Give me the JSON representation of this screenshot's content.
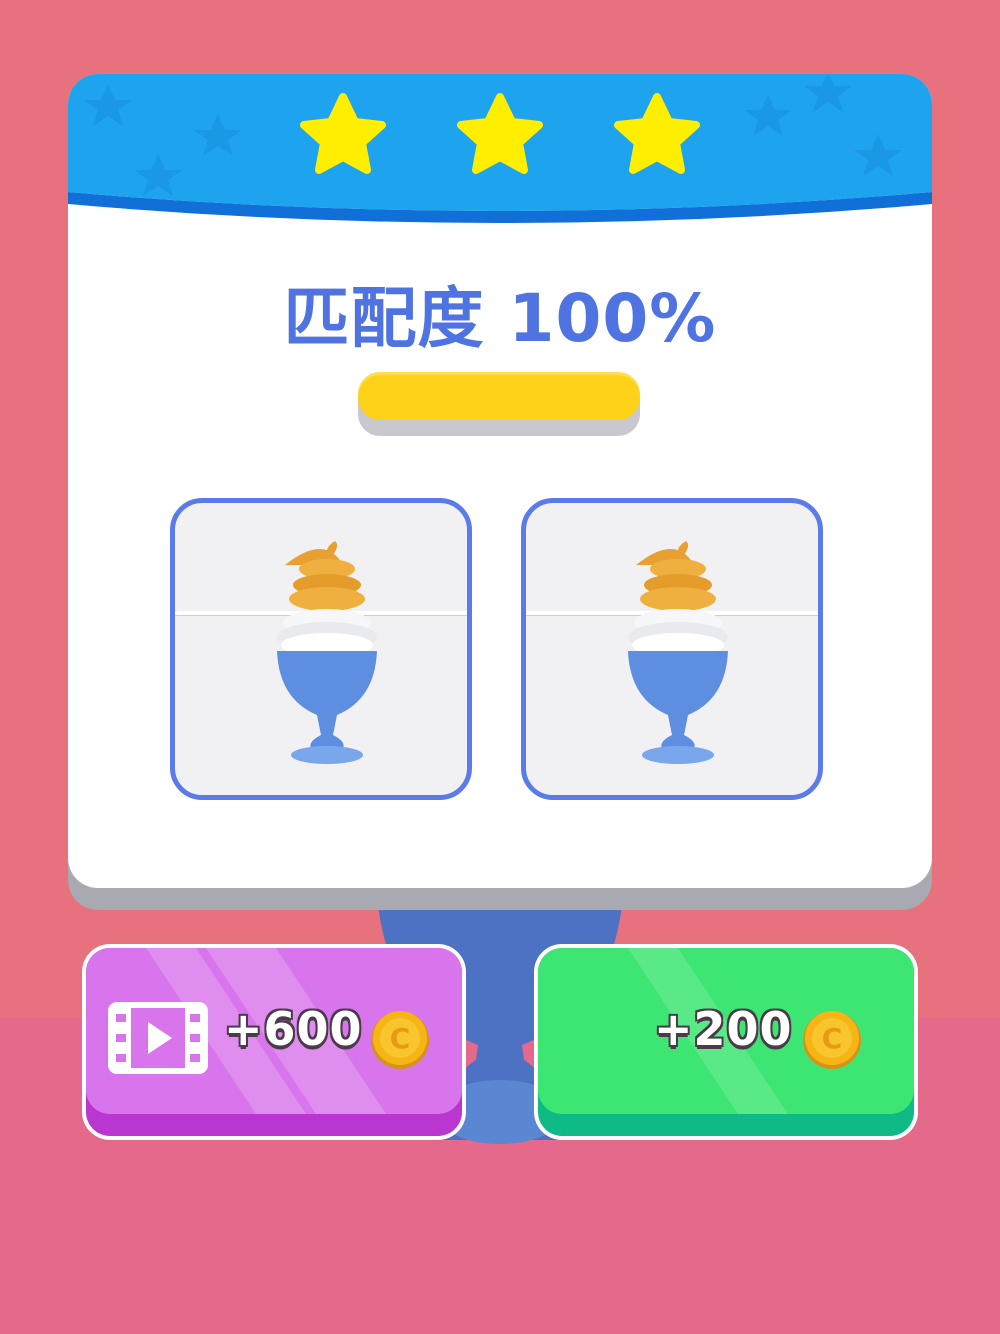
{
  "result": {
    "stars_earned": 3,
    "stars_total": 3,
    "match_label": "匹配度",
    "match_value": "100%",
    "match_progress_fraction": 1.0
  },
  "preview": {
    "left_card": "target-dessert",
    "right_card": "player-dessert"
  },
  "buttons": {
    "ad_reward_label": "+600",
    "free_reward_label": "+200",
    "coin_glyph": "C"
  },
  "colors": {
    "banner_blue": "#1ea3ee",
    "star_yellow": "#ffee00",
    "match_text": "#4f73e0",
    "progress_yellow": "#ffd21a",
    "card_border": "#5c7bea",
    "ad_button": "#d874ec",
    "free_button": "#3de672",
    "coin_gold": "#f6b515"
  },
  "icons": {
    "stars": "star-icon",
    "video": "video-ad-icon",
    "coin": "coin-icon"
  }
}
